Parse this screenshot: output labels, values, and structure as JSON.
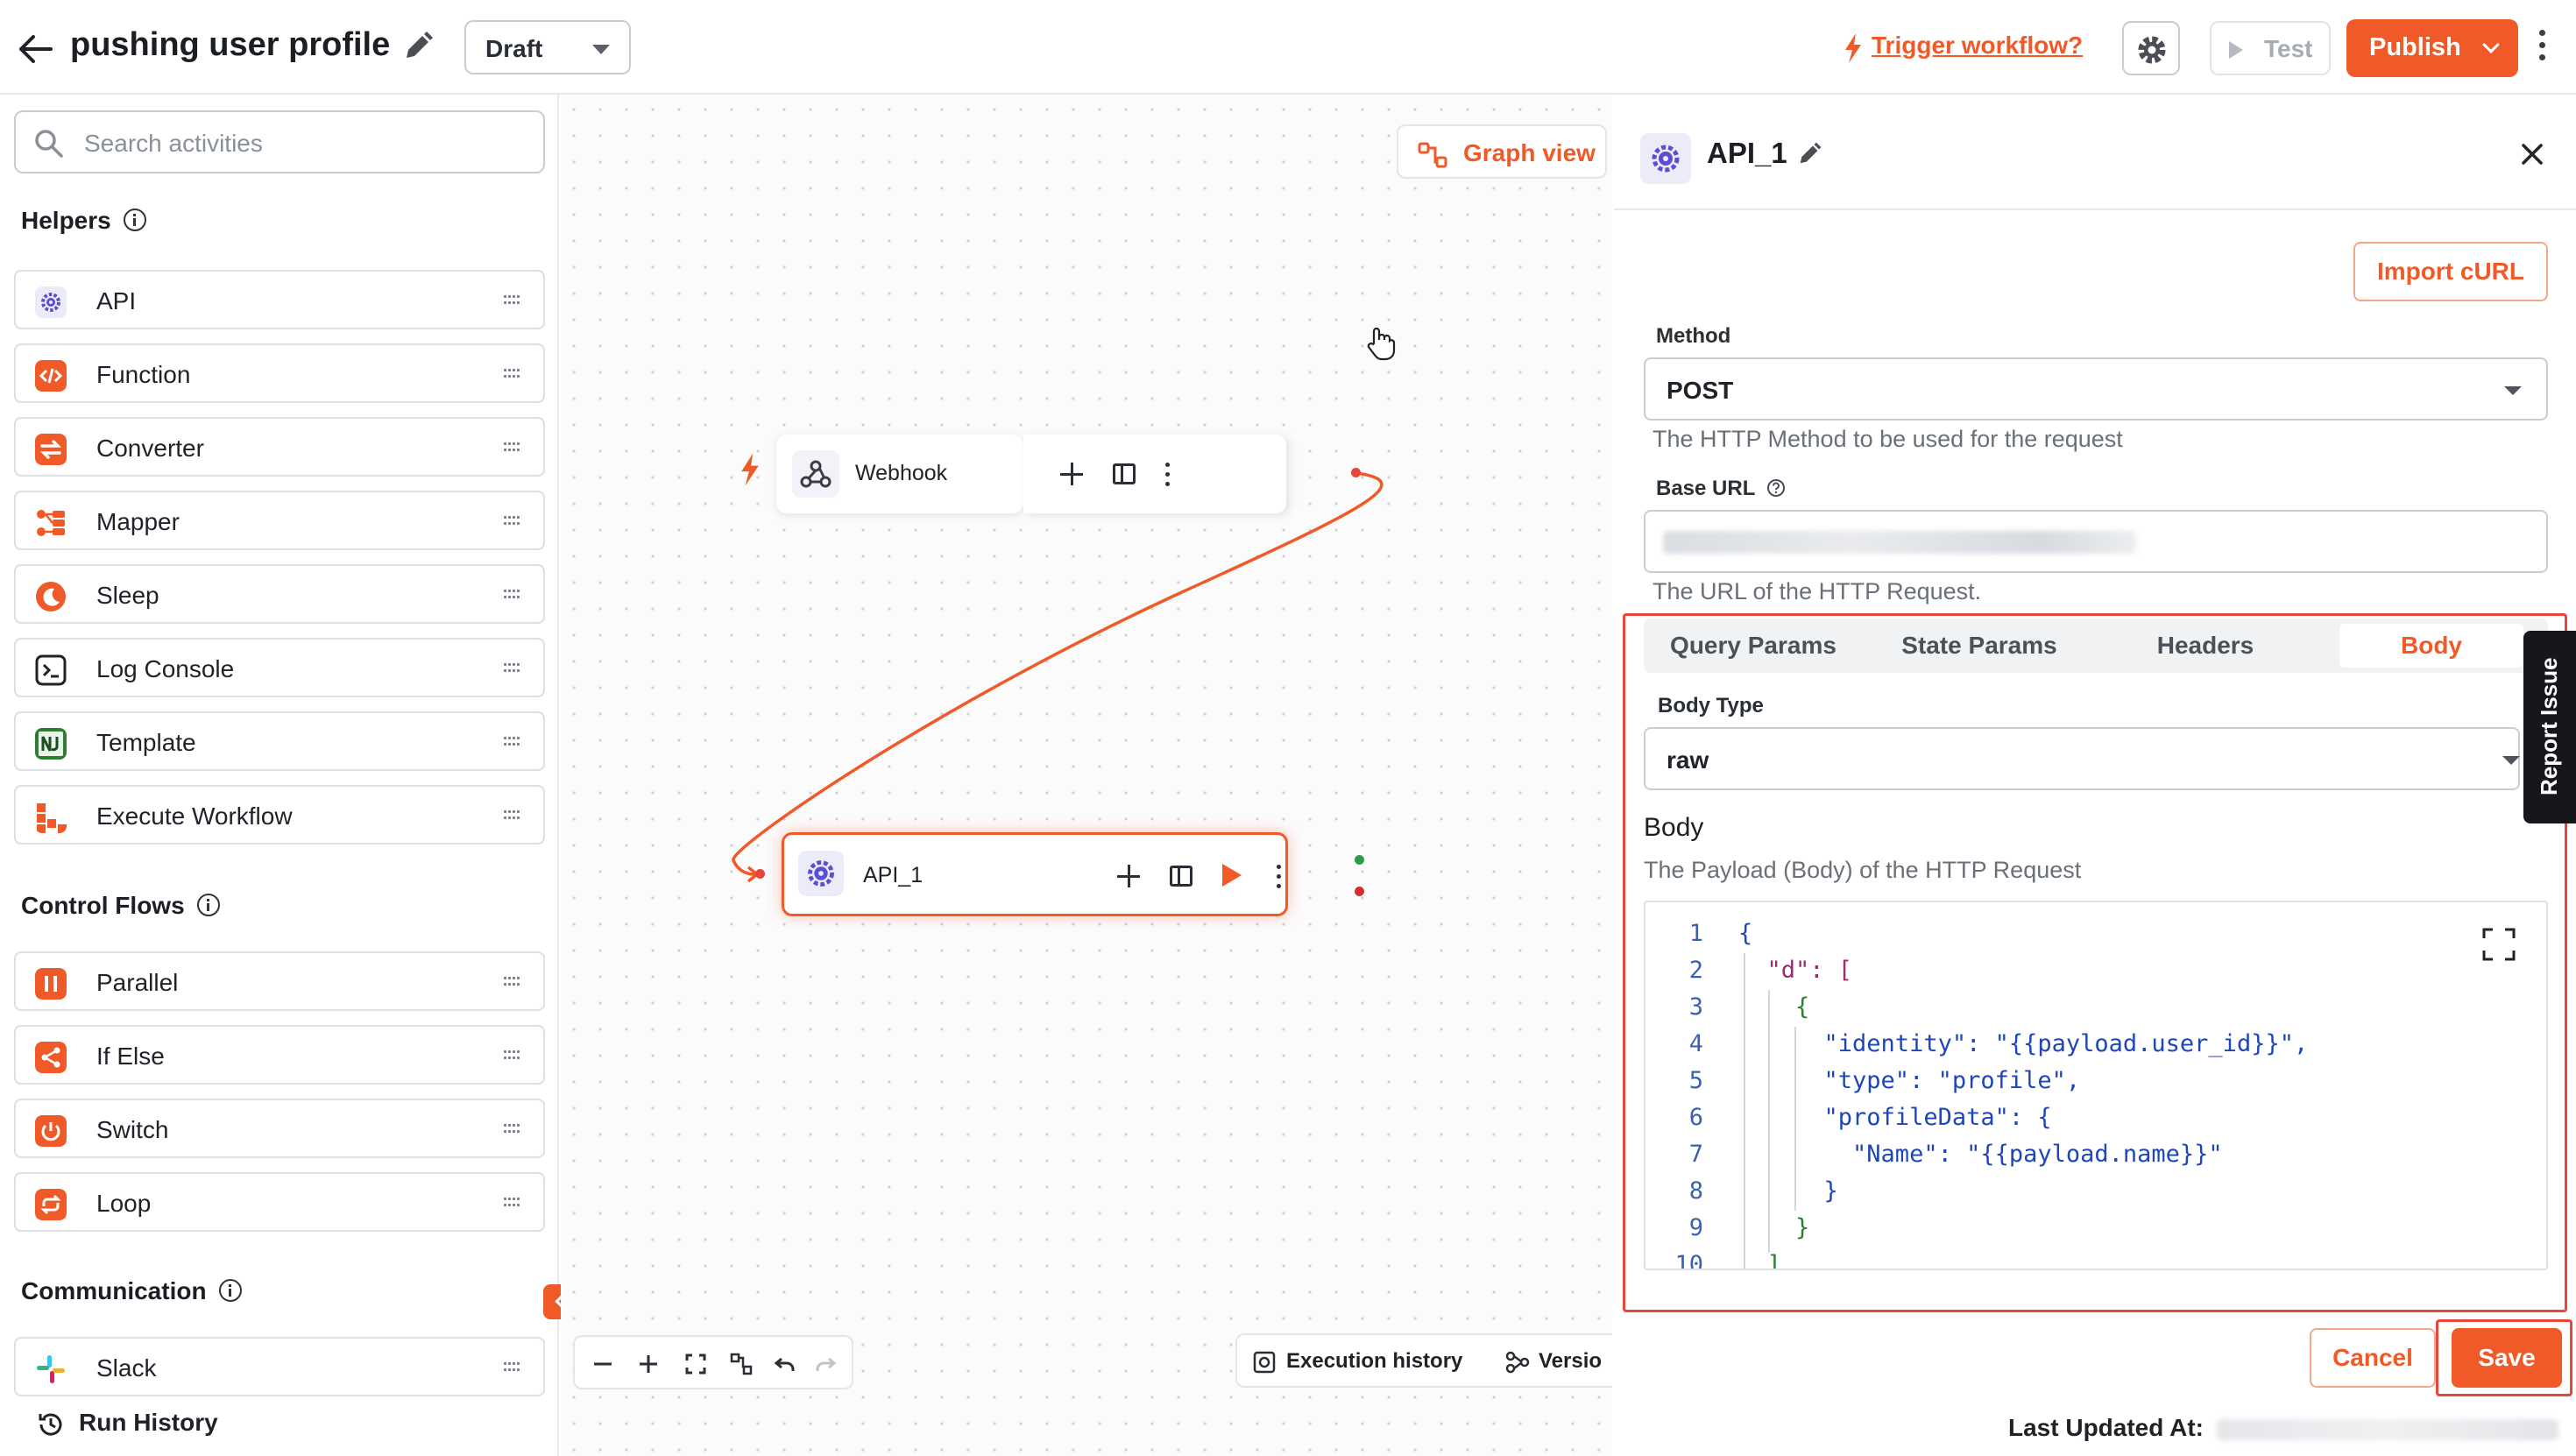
{
  "header": {
    "workflow_title": "pushing user profile",
    "status_value": "Draft",
    "trigger_link": "Trigger workflow?",
    "test_label": "Test",
    "publish_label": "Publish"
  },
  "sidebar": {
    "search_placeholder": "Search activities",
    "sections": [
      {
        "title": "Helpers",
        "items": [
          {
            "label": "API",
            "icon": "api-gear-icon",
            "color": "#5b4fd1"
          },
          {
            "label": "Function",
            "icon": "code-icon",
            "color": "#f05a28"
          },
          {
            "label": "Converter",
            "icon": "swap-icon",
            "color": "#f05a28"
          },
          {
            "label": "Mapper",
            "icon": "mapper-icon",
            "color": "#f05a28"
          },
          {
            "label": "Sleep",
            "icon": "moon-icon",
            "color": "#f05a28"
          },
          {
            "label": "Log Console",
            "icon": "terminal-icon",
            "color": "#1f2328"
          },
          {
            "label": "Template",
            "icon": "template-icon",
            "color": "#2e7d32"
          },
          {
            "label": "Execute Workflow",
            "icon": "execute-workflow-icon",
            "color": "#f05a28"
          }
        ]
      },
      {
        "title": "Control Flows",
        "items": [
          {
            "label": "Parallel",
            "icon": "parallel-icon",
            "color": "#f05a28"
          },
          {
            "label": "If Else",
            "icon": "branch-icon",
            "color": "#f05a28"
          },
          {
            "label": "Switch",
            "icon": "power-switch-icon",
            "color": "#f05a28"
          },
          {
            "label": "Loop",
            "icon": "loop-icon",
            "color": "#f05a28"
          }
        ]
      },
      {
        "title": "Communication",
        "items": [
          {
            "label": "Slack",
            "icon": "slack-icon",
            "color": "#4a154b"
          }
        ]
      }
    ],
    "run_history": "Run History"
  },
  "canvas": {
    "graph_view_label": "Graph view",
    "nodes": [
      {
        "label": "Webhook",
        "icon": "webhook-icon"
      },
      {
        "label": "API_1",
        "icon": "api-gear-icon"
      }
    ],
    "execution_history": "Execution history",
    "versions": "Versio"
  },
  "panel": {
    "title": "API_1",
    "import_curl": "Import cURL",
    "method_label": "Method",
    "method_value": "POST",
    "method_help": "The HTTP Method to be used for the request",
    "base_url_label": "Base URL",
    "base_url_help": "The URL of the HTTP Request.",
    "tabs": [
      "Query Params",
      "State Params",
      "Headers",
      "Body"
    ],
    "active_tab": "Body",
    "body_type_label": "Body Type",
    "body_type_value": "raw",
    "body_title": "Body",
    "body_help": "The Payload (Body) of the HTTP Request",
    "code_lines": [
      "{",
      "  \"d\": [",
      "    {",
      "      \"identity\": \"{{payload.user_id}}\",",
      "      \"type\": \"profile\",",
      "      \"profileData\": {",
      "        \"Name\": \"{{payload.name}}\"",
      "      }",
      "    }",
      "  ]"
    ],
    "cancel_label": "Cancel",
    "save_label": "Save",
    "last_updated_label": "Last Updated At:",
    "report_issue": "Report Issue"
  },
  "colors": {
    "accent": "#f05a28",
    "highlight": "#e8453c",
    "api_icon": "#5b4fd1",
    "port_success": "#2e9b4a",
    "port_error": "#d32f2f"
  }
}
